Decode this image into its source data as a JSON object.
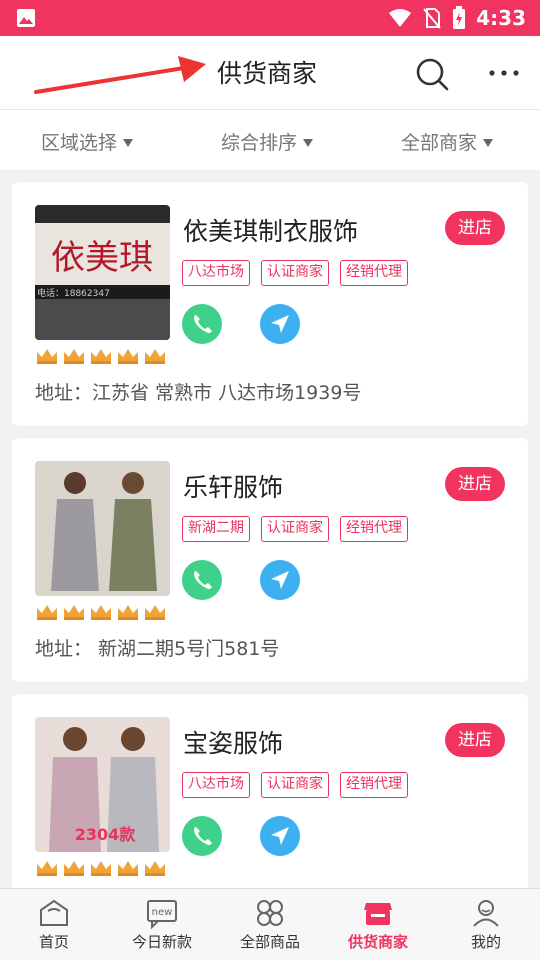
{
  "status_bar": {
    "time": "4:33"
  },
  "header": {
    "title": "供货商家",
    "search_icon": "search-icon",
    "more_icon": "more-icon"
  },
  "filters": [
    {
      "label": "区域选择"
    },
    {
      "label": "综合排序"
    },
    {
      "label": "全部商家"
    }
  ],
  "shops": [
    {
      "name": "依美琪制衣服饰",
      "enter_label": "进店",
      "tags": [
        "八达市场",
        "认证商家",
        "经销代理"
      ],
      "address": "地址：江苏省 常熟市 八达市场1939号",
      "rating_crowns": 5,
      "thumb_sign": "依美琪",
      "thumb_phone": "电话：18862347"
    },
    {
      "name": "乐轩服饰",
      "enter_label": "进店",
      "tags": [
        "新湖二期",
        "认证商家",
        "经销代理"
      ],
      "address": "地址：  新湖二期5号门581号",
      "rating_crowns": 5
    },
    {
      "name": "宝姿服饰",
      "enter_label": "进店",
      "tags": [
        "八达市场",
        "认证商家",
        "经销代理"
      ],
      "address": "",
      "rating_crowns": 5,
      "thumb_badge": "2304款"
    }
  ],
  "tabbar": {
    "items": [
      {
        "label": "首页",
        "icon": "home-icon"
      },
      {
        "label": "今日新款",
        "icon": "new-icon"
      },
      {
        "label": "全部商品",
        "icon": "grid-icon"
      },
      {
        "label": "供货商家",
        "icon": "store-icon"
      },
      {
        "label": "我的",
        "icon": "user-icon"
      }
    ],
    "active_index": 3
  },
  "colors": {
    "accent": "#f0335f",
    "phone": "#3fd08a",
    "nav": "#3db1ef",
    "crown": "#f2a23a"
  }
}
